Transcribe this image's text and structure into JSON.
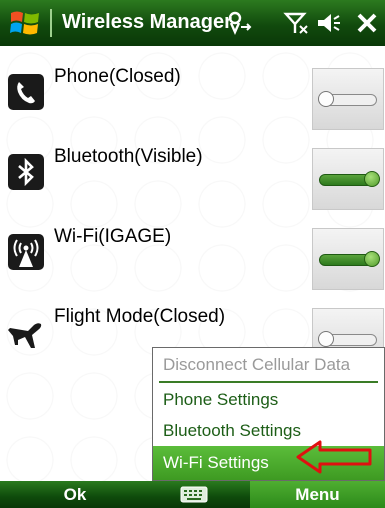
{
  "titlebar": {
    "title": "Wireless Manager",
    "icons": [
      "windows-start-icon",
      "data-connection-icon",
      "signal-off-icon",
      "volume-icon",
      "close-icon"
    ]
  },
  "rows": [
    {
      "label": "Phone(Closed)",
      "icon": "phone-icon",
      "state": "off"
    },
    {
      "label": "Bluetooth(Visible)",
      "icon": "bluetooth-icon",
      "state": "on"
    },
    {
      "label": "Wi-Fi(IGAGE)",
      "icon": "wifi-icon",
      "state": "on"
    },
    {
      "label": "Flight Mode(Closed)",
      "icon": "airplane-icon",
      "state": "off"
    }
  ],
  "menu": {
    "items": [
      {
        "label": "Disconnect Cellular Data",
        "state": "disabled"
      },
      {
        "label": "Phone Settings",
        "state": "normal"
      },
      {
        "label": "Bluetooth Settings",
        "state": "normal"
      },
      {
        "label": "Wi-Fi Settings",
        "state": "selected"
      }
    ]
  },
  "softkeys": {
    "left": "Ok",
    "right": "Menu",
    "center_icon": "keyboard-icon"
  },
  "colors": {
    "titlebar": "#114a0d",
    "toggle_on": "#3e8a25",
    "menu_selected": "#4caf30",
    "menu_text": "#1d5e17",
    "annotation_arrow": "#e01010"
  }
}
